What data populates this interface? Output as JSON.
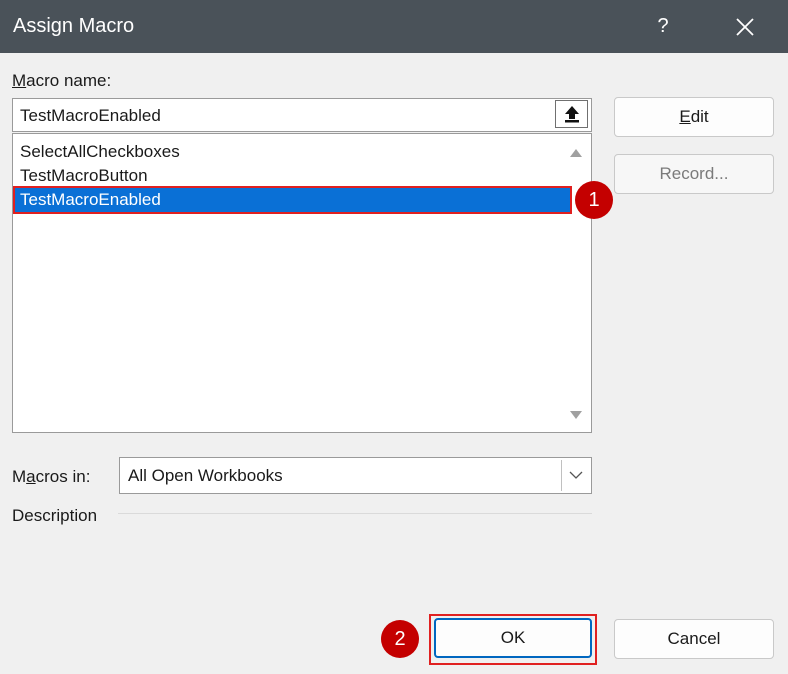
{
  "dialog": {
    "title": "Assign Macro",
    "help_label": "?"
  },
  "macro_name": {
    "label_mnemonic": "M",
    "label_rest": "acro name:",
    "value": "TestMacroEnabled"
  },
  "macro_list": {
    "items": [
      {
        "label": "SelectAllCheckboxes",
        "selected": false
      },
      {
        "label": "TestMacroButton",
        "selected": false
      },
      {
        "label": "TestMacroEnabled",
        "selected": true
      }
    ]
  },
  "buttons": {
    "edit_mnemonic": "E",
    "edit_rest": "dit",
    "record_label": "Record...",
    "ok_label": "OK",
    "cancel_label": "Cancel"
  },
  "macros_in": {
    "label_pre": "M",
    "label_mnemonic": "a",
    "label_rest": "cros in:",
    "value": "All Open Workbooks"
  },
  "description": {
    "label": "Description"
  },
  "annotations": {
    "step1": "1",
    "step2": "2",
    "highlight_color": "#e02020",
    "badge_color": "#c40000"
  },
  "colors": {
    "titlebar": "#4a5259",
    "selection": "#0a70d6",
    "default_button_border": "#0067c0"
  }
}
